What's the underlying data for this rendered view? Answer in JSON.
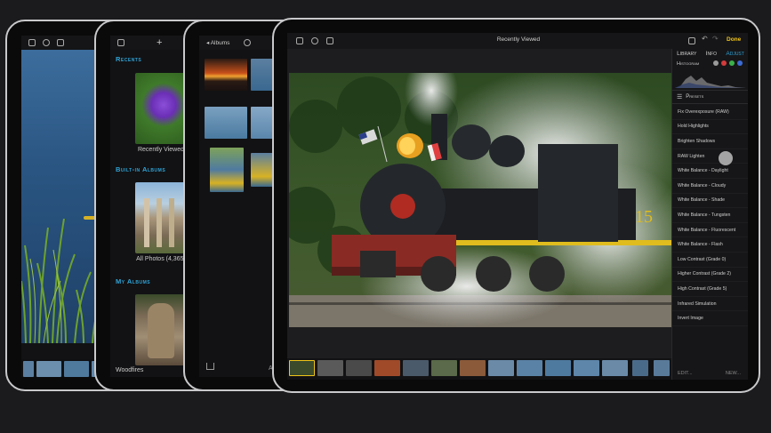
{
  "tablet1": {
    "water_color": "#2f5a86"
  },
  "tablet2": {
    "sections": {
      "recents": "Recents",
      "builtin": "Built-in Albums",
      "my_albums": "My Albums"
    },
    "albums": {
      "recently_viewed": "Recently Viewed",
      "all_photos": "All Photos (4,365)",
      "woodfires": "Woodfires"
    }
  },
  "tablet3": {
    "back_label": "Albums",
    "bottom_partial_text": "A"
  },
  "tablet4": {
    "title": "Recently Viewed",
    "done_label": "Done",
    "tabs": [
      "Library",
      "Info",
      "Adjust"
    ],
    "active_tab": "Adjust",
    "histogram_label": "Histogram",
    "histogram_dot_colors": [
      "#9a9a9a",
      "#d43b3b",
      "#3bb14a",
      "#3b6bd4"
    ],
    "presets_header": "Presets",
    "presets": [
      "Fix Overexposure (RAW)",
      "Hold Highlights",
      "Brighten Shadows",
      "RAW Lighten",
      "White Balance - Daylight",
      "White Balance - Cloudy",
      "White Balance - Shade",
      "White Balance - Tungsten",
      "White Balance - Fluorescent",
      "White Balance - Flash",
      "Low Contrast (Grade 0)",
      "Higher Contrast (Grade 2)",
      "High Contrast (Grade 5)",
      "Infrared Simulation",
      "Invert Image"
    ],
    "footer": {
      "edit_label": "EDIT...",
      "new_label": "NEW..."
    },
    "locomotive_number": "15",
    "accent_color": "#f0c419"
  }
}
